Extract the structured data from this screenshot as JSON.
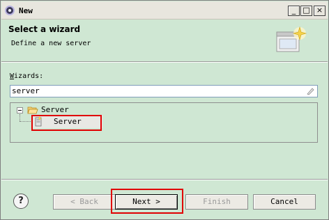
{
  "window": {
    "title": "New"
  },
  "title_buttons": {
    "minimize": "_",
    "maximize": "□",
    "close": "×"
  },
  "banner": {
    "title": "Select a wizard",
    "description": "Define a new server"
  },
  "wizards": {
    "label": "Wizards:",
    "filter_value": "server"
  },
  "tree": {
    "parent_label": "Server",
    "child_label": "Server"
  },
  "footer": {
    "help_label": "?",
    "back_label": "< Back",
    "next_label": "Next >",
    "finish_label": "Finish",
    "cancel_label": "Cancel"
  },
  "colors": {
    "background": "#cfe7d3",
    "highlight": "#e00000"
  }
}
